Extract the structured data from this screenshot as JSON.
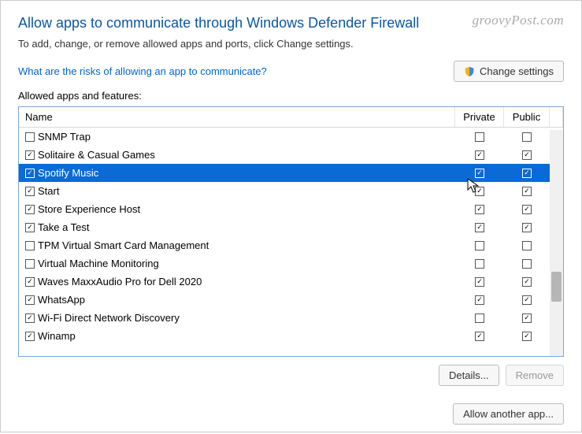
{
  "watermark": "groovyPost.com",
  "heading": "Allow apps to communicate through Windows Defender Firewall",
  "subtext": "To add, change, or remove allowed apps and ports, click Change settings.",
  "risks_link": "What are the risks of allowing an app to communicate?",
  "change_settings_label": "Change settings",
  "section_label": "Allowed apps and features:",
  "columns": {
    "name": "Name",
    "private": "Private",
    "public": "Public"
  },
  "rows": [
    {
      "name": "SNMP Trap",
      "enabled": false,
      "private": false,
      "public": false,
      "selected": false
    },
    {
      "name": "Solitaire & Casual Games",
      "enabled": true,
      "private": true,
      "public": true,
      "selected": false
    },
    {
      "name": "Spotify Music",
      "enabled": true,
      "private": true,
      "public": true,
      "selected": true
    },
    {
      "name": "Start",
      "enabled": true,
      "private": true,
      "public": true,
      "selected": false
    },
    {
      "name": "Store Experience Host",
      "enabled": true,
      "private": true,
      "public": true,
      "selected": false
    },
    {
      "name": "Take a Test",
      "enabled": true,
      "private": true,
      "public": true,
      "selected": false
    },
    {
      "name": "TPM Virtual Smart Card Management",
      "enabled": false,
      "private": false,
      "public": false,
      "selected": false
    },
    {
      "name": "Virtual Machine Monitoring",
      "enabled": false,
      "private": false,
      "public": false,
      "selected": false
    },
    {
      "name": "Waves MaxxAudio Pro for Dell 2020",
      "enabled": true,
      "private": true,
      "public": true,
      "selected": false
    },
    {
      "name": "WhatsApp",
      "enabled": true,
      "private": true,
      "public": true,
      "selected": false
    },
    {
      "name": "Wi-Fi Direct Network Discovery",
      "enabled": true,
      "private": false,
      "public": true,
      "selected": false
    },
    {
      "name": "Winamp",
      "enabled": true,
      "private": true,
      "public": true,
      "selected": false
    }
  ],
  "buttons": {
    "details": "Details...",
    "remove": "Remove",
    "allow_another": "Allow another app..."
  },
  "checkmark_glyph": "✓"
}
